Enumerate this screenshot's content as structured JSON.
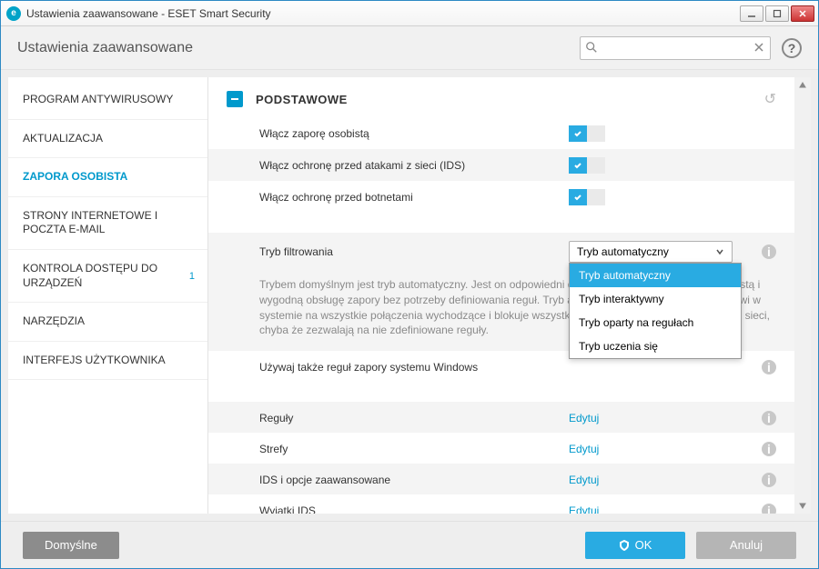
{
  "window": {
    "title": "Ustawienia zaawansowane - ESET Smart Security"
  },
  "header": {
    "title": "Ustawienia zaawansowane",
    "search_placeholder": ""
  },
  "sidebar": {
    "items": [
      {
        "label": "PROGRAM ANTYWIRUSOWY",
        "active": false
      },
      {
        "label": "AKTUALIZACJA",
        "active": false
      },
      {
        "label": "ZAPORA OSOBISTA",
        "active": true
      },
      {
        "label": "STRONY INTERNETOWE I POCZTA E-MAIL",
        "active": false
      },
      {
        "label": "KONTROLA DOSTĘPU DO URZĄDZEŃ",
        "active": false,
        "badge": "1"
      },
      {
        "label": "NARZĘDZIA",
        "active": false
      },
      {
        "label": "INTERFEJS UŻYTKOWNIKA",
        "active": false
      }
    ]
  },
  "section": {
    "title": "PODSTAWOWE"
  },
  "toggles": [
    {
      "label": "Włącz zaporę osobistą",
      "on": true
    },
    {
      "label": "Włącz ochronę przed atakami z sieci (IDS)",
      "on": true
    },
    {
      "label": "Włącz ochronę przed botnetami",
      "on": true
    }
  ],
  "filter_mode": {
    "label": "Tryb filtrowania",
    "value": "Tryb automatyczny",
    "options": [
      "Tryb automatyczny",
      "Tryb interaktywny",
      "Tryb oparty na regułach",
      "Tryb uczenia się"
    ],
    "description": "Trybem domyślnym jest tryb automatyczny. Jest on odpowiedni dla użytkowników preferujących prostą i wygodną obsługę zapory bez potrzeby definiowania reguł. Tryb automatyczny zezwala użytkownikowi w systemie na wszystkie połączenia wychodzące i blokuje wszystkie nowe połączenia przychodzące z sieci, chyba że zezwalają na nie zdefiniowane reguły."
  },
  "win_rules": {
    "label": "Używaj także reguł zapory systemu Windows"
  },
  "edit_rows": [
    {
      "label": "Reguły",
      "action": "Edytuj"
    },
    {
      "label": "Strefy",
      "action": "Edytuj"
    },
    {
      "label": "IDS i opcje zaawansowane",
      "action": "Edytuj"
    },
    {
      "label": "Wyjątki IDS",
      "action": "Edytuj"
    }
  ],
  "footer": {
    "default": "Domyślne",
    "ok": "OK",
    "cancel": "Anuluj"
  }
}
